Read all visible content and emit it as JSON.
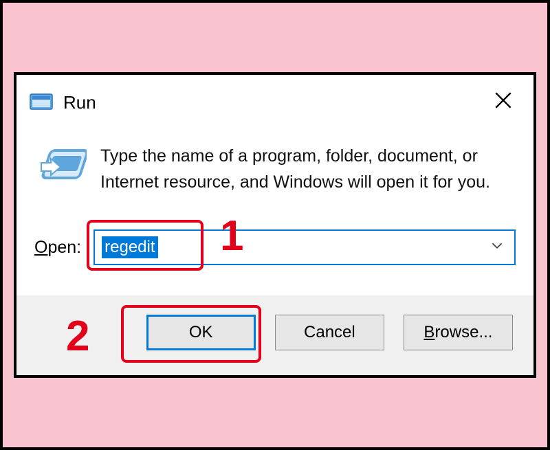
{
  "dialog": {
    "title": "Run",
    "description": "Type the name of a program, folder, document, or Internet resource, and Windows will open it for you.",
    "open_label_underline": "O",
    "open_label_rest": "pen:",
    "input_value": "regedit",
    "buttons": {
      "ok": "OK",
      "cancel": "Cancel",
      "browse_underline": "B",
      "browse_rest": "rowse..."
    }
  },
  "annotations": {
    "step1": "1",
    "step2": "2"
  }
}
